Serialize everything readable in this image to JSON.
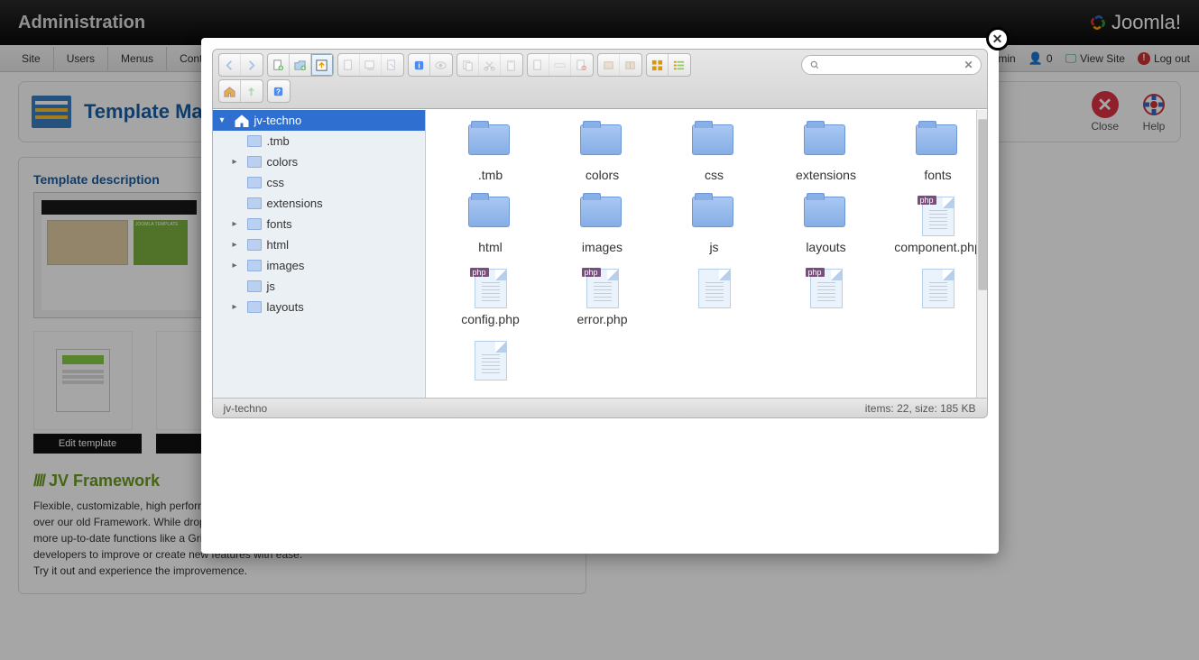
{
  "header": {
    "title": "Administration",
    "brand": "Joomla!"
  },
  "menubar": {
    "items": [
      "Site",
      "Users",
      "Menus",
      "Conte"
    ],
    "right": {
      "admin": "dmin",
      "visitors_count": "0",
      "view_site": "View Site",
      "logout": "Log out"
    }
  },
  "page": {
    "title": "Template Mar",
    "close_label": "Close",
    "help_label": "Help"
  },
  "card": {
    "title": "Template description",
    "edit_template": "Edit template",
    "fw_slashes": "////",
    "fw_title": "JV Framework",
    "desc_line1": "Flexible, customizable, high performance and developer-friendly. JV Framework 3.0 is a steep improvemence over our old Framework. While dropping some functions like drag and drop, it had gained several new ones, more up-to-date functions like a Grid layout control, a Responsive Design and a modular nature, allowing developers to improve or create new features with ease.",
    "desc_line2": "Try it out and experience the improvemence."
  },
  "filemanager": {
    "search_placeholder": "",
    "tree": {
      "root": "jv-techno",
      "children": [
        {
          "label": ".tmb",
          "expandable": false
        },
        {
          "label": "colors",
          "expandable": true
        },
        {
          "label": "css",
          "expandable": false
        },
        {
          "label": "extensions",
          "expandable": false
        },
        {
          "label": "fonts",
          "expandable": true
        },
        {
          "label": "html",
          "expandable": true
        },
        {
          "label": "images",
          "expandable": true
        },
        {
          "label": "js",
          "expandable": false
        },
        {
          "label": "layouts",
          "expandable": true
        }
      ]
    },
    "files": [
      {
        "name": ".tmb",
        "type": "folder"
      },
      {
        "name": "colors",
        "type": "folder"
      },
      {
        "name": "css",
        "type": "folder"
      },
      {
        "name": "extensions",
        "type": "folder"
      },
      {
        "name": "fonts",
        "type": "folder"
      },
      {
        "name": "html",
        "type": "folder"
      },
      {
        "name": "images",
        "type": "folder"
      },
      {
        "name": "js",
        "type": "folder"
      },
      {
        "name": "layouts",
        "type": "folder"
      },
      {
        "name": "component.php",
        "type": "php"
      },
      {
        "name": "config.php",
        "type": "php"
      },
      {
        "name": "error.php",
        "type": "php"
      },
      {
        "name": "",
        "type": "file"
      },
      {
        "name": "",
        "type": "php"
      },
      {
        "name": "",
        "type": "file"
      },
      {
        "name": "",
        "type": "file"
      }
    ],
    "status_path": "jv-techno",
    "status_info": "items: 22, size: 185 KB"
  }
}
